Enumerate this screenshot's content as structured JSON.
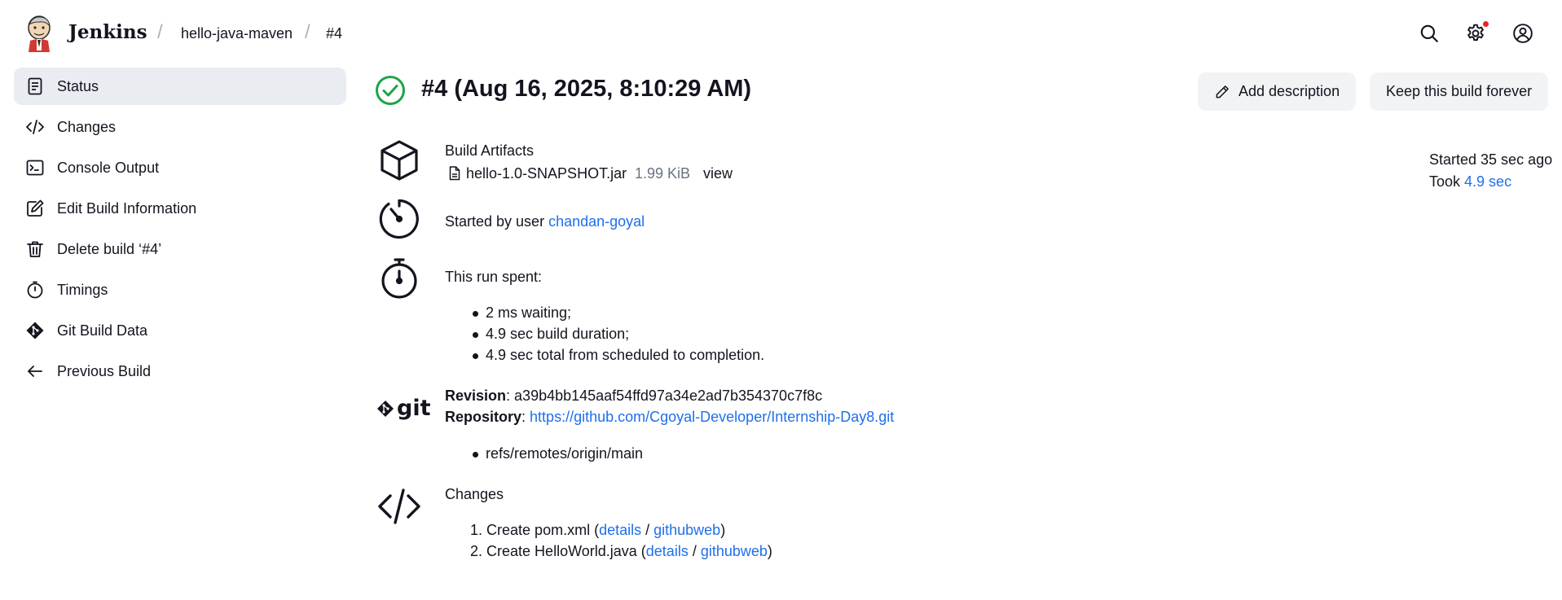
{
  "header": {
    "brand": "Jenkins",
    "breadcrumbs": [
      "hello-java-maven",
      "#4"
    ]
  },
  "sidebar": {
    "items": [
      {
        "label": "Status",
        "icon": "document-icon",
        "active": true
      },
      {
        "label": "Changes",
        "icon": "code-icon"
      },
      {
        "label": "Console Output",
        "icon": "terminal-icon"
      },
      {
        "label": "Edit Build Information",
        "icon": "edit-icon"
      },
      {
        "label": "Delete build ‘#4’",
        "icon": "trash-icon"
      },
      {
        "label": "Timings",
        "icon": "stopwatch-icon"
      },
      {
        "label": "Git Build Data",
        "icon": "git-icon"
      },
      {
        "label": "Previous Build",
        "icon": "arrow-left-icon"
      }
    ]
  },
  "build": {
    "title": "#4 (Aug 16, 2025, 8:10:29 AM)",
    "status_color": "#1ea446",
    "add_description_label": "Add description",
    "keep_forever_label": "Keep this build forever",
    "started_ago": "Started 35 sec ago",
    "took_prefix": "Took ",
    "took_value": "4.9 sec"
  },
  "artifacts": {
    "heading": "Build Artifacts",
    "file_name": "hello-1.0-SNAPSHOT.jar",
    "file_size": "1.99 KiB",
    "view_label": "view"
  },
  "cause": {
    "prefix": "Started by user ",
    "user": "chandan-goyal"
  },
  "timing": {
    "heading": "This run spent:",
    "items": [
      "2 ms waiting;",
      "4.9 sec build duration;",
      "4.9 sec total from scheduled to completion."
    ]
  },
  "git": {
    "logo_text": "git",
    "revision_label": "Revision",
    "revision": "a39b4bb145aaf54ffd97a34e2ad7b354370c7f8c",
    "repository_label": "Repository",
    "repository": "https://github.com/Cgoyal-Developer/Internship-Day8.git",
    "refs": [
      "refs/remotes/origin/main"
    ]
  },
  "changes": {
    "heading": "Changes",
    "items": [
      {
        "n": "1.",
        "text": "Create pom.xml",
        "details": "details",
        "web": "githubweb"
      },
      {
        "n": "2.",
        "text": "Create HelloWorld.java",
        "details": "details",
        "web": "githubweb"
      }
    ]
  },
  "colors": {
    "link": "#1f6feb",
    "active_bg": "#e9edf2",
    "button_bg": "#f1f3f5"
  }
}
